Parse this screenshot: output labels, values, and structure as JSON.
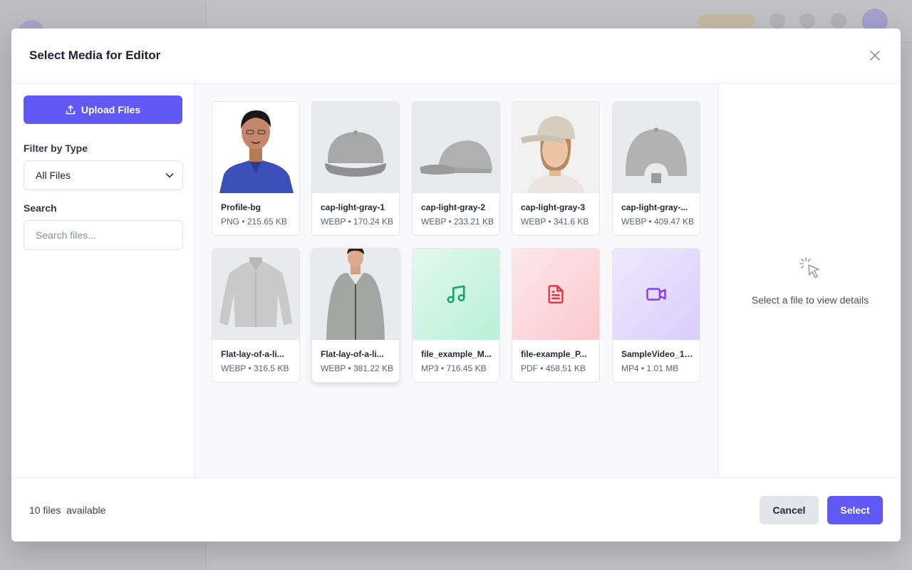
{
  "modal": {
    "title": "Select Media for Editor"
  },
  "sidebar": {
    "upload_label": "Upload Files",
    "filter_label": "Filter by Type",
    "filter_value": "All Files",
    "search_label": "Search",
    "search_placeholder": "Search files..."
  },
  "files": [
    {
      "name": "Profile-bg",
      "meta": "PNG • 215.65 KB",
      "kind": "person"
    },
    {
      "name": "cap-light-gray-1",
      "meta": "WEBP • 170.24 KB",
      "kind": "cap-front"
    },
    {
      "name": "cap-light-gray-2",
      "meta": "WEBP • 233.21 KB",
      "kind": "cap-side"
    },
    {
      "name": "cap-light-gray-3",
      "meta": "WEBP • 341.6 KB",
      "kind": "cap-model"
    },
    {
      "name": "cap-light-gray-...",
      "meta": "WEBP • 409.47 KB",
      "kind": "cap-back"
    },
    {
      "name": "Flat-lay-of-a-li...",
      "meta": "WEBP • 316.5 KB",
      "kind": "jacket"
    },
    {
      "name": "Flat-lay-of-a-li...",
      "meta": "WEBP • 381.22 KB",
      "kind": "jacket-model"
    },
    {
      "name": "file_example_M...",
      "meta": "MP3 • 716.45 KB",
      "kind": "audio"
    },
    {
      "name": "file-example_P...",
      "meta": "PDF • 458.51 KB",
      "kind": "pdf"
    },
    {
      "name": "SampleVideo_12...",
      "meta": "MP4 • 1.01 MB",
      "kind": "video"
    }
  ],
  "details": {
    "empty_text": "Select a file to view details",
    "icon": "cursor-click-icon"
  },
  "footer": {
    "count_text": "10 files  available",
    "cancel_label": "Cancel",
    "select_label": "Select"
  },
  "colors": {
    "accent": "#6158f6",
    "audio_icon": "#16a36a",
    "pdf_icon": "#e5303f",
    "video_icon": "#8a3ef0"
  }
}
